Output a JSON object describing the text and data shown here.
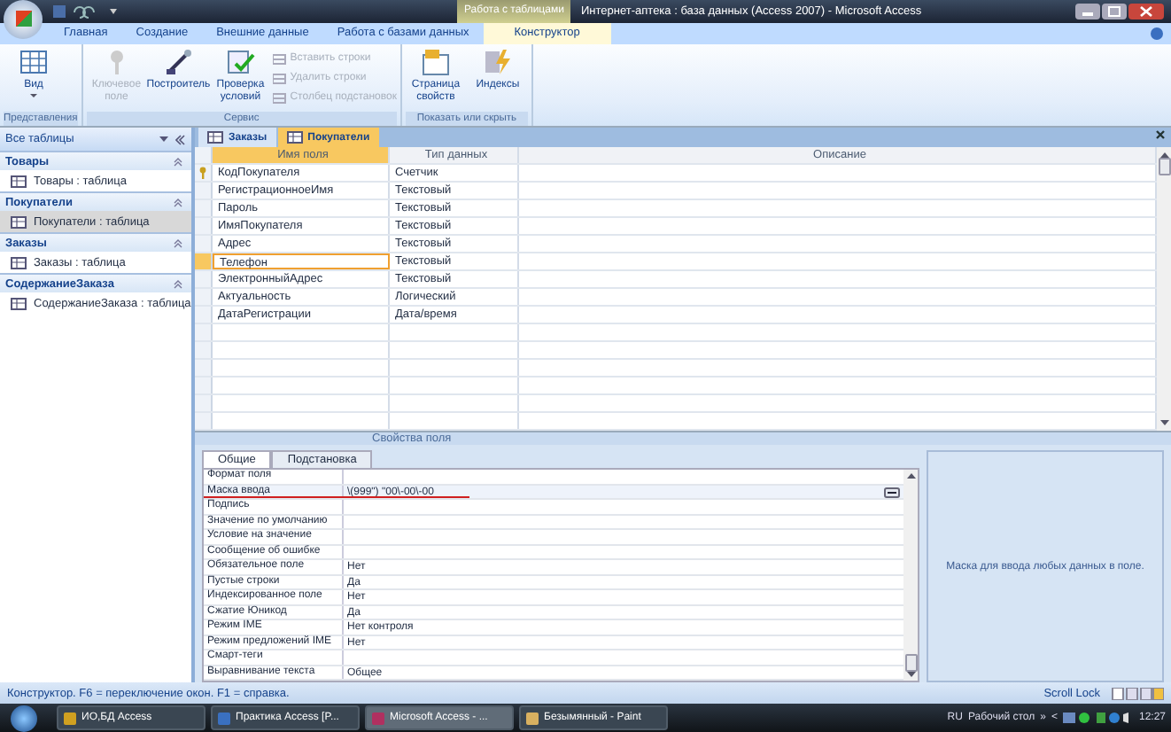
{
  "window": {
    "title": "Интернет-аптека : база данных (Access 2007) - Microsoft Access",
    "context_group": "Работа с таблицами"
  },
  "ribbon": {
    "tabs": [
      {
        "label": "Главная",
        "selected": false,
        "contextual": false
      },
      {
        "label": "Создание",
        "selected": false,
        "contextual": false
      },
      {
        "label": "Внешние данные",
        "selected": false,
        "contextual": false
      },
      {
        "label": "Работа с базами данных",
        "selected": false,
        "contextual": false
      },
      {
        "label": "Конструктор",
        "selected": true,
        "contextual": true
      }
    ],
    "groups": [
      {
        "label": "Представления",
        "buttons": [
          {
            "label": "Вид",
            "kind": "large",
            "disabled": false,
            "dropdown": true
          }
        ]
      },
      {
        "label": "Сервис",
        "buttons": [
          {
            "label": "Ключевое поле",
            "kind": "large",
            "disabled": true
          },
          {
            "label": "Построитель",
            "kind": "large",
            "disabled": false
          },
          {
            "label": "Проверка условий",
            "kind": "large",
            "disabled": false
          },
          {
            "label": "Вставить строки",
            "kind": "small",
            "disabled": true
          },
          {
            "label": "Удалить строки",
            "kind": "small",
            "disabled": true
          },
          {
            "label": "Столбец подстановок",
            "kind": "small",
            "disabled": true
          }
        ]
      },
      {
        "label": "Показать или скрыть",
        "buttons": [
          {
            "label": "Страница свойств",
            "kind": "large",
            "disabled": false
          },
          {
            "label": "Индексы",
            "kind": "large",
            "disabled": false
          }
        ]
      }
    ]
  },
  "navigation": {
    "header": "Все таблицы",
    "groups": [
      {
        "title": "Товары",
        "items": [
          {
            "label": "Товары : таблица",
            "selected": false
          }
        ]
      },
      {
        "title": "Покупатели",
        "items": [
          {
            "label": "Покупатели : таблица",
            "selected": true
          }
        ]
      },
      {
        "title": "Заказы",
        "items": [
          {
            "label": "Заказы : таблица",
            "selected": false
          }
        ]
      },
      {
        "title": "СодержаниеЗаказа",
        "items": [
          {
            "label": "СодержаниеЗаказа : таблица",
            "selected": false
          }
        ]
      }
    ]
  },
  "document_tabs": [
    {
      "label": "Заказы",
      "selected": false
    },
    {
      "label": "Покупатели",
      "selected": true
    }
  ],
  "design_grid": {
    "columns": [
      "Имя поля",
      "Тип данных",
      "Описание"
    ],
    "rows": [
      {
        "name": "КодПокупателя",
        "type": "Счетчик",
        "primary_key": true,
        "selected": false
      },
      {
        "name": "РегистрационноеИмя",
        "type": "Текстовый",
        "primary_key": false,
        "selected": false
      },
      {
        "name": "Пароль",
        "type": "Текстовый",
        "primary_key": false,
        "selected": false
      },
      {
        "name": "ИмяПокупателя",
        "type": "Текстовый",
        "primary_key": false,
        "selected": false
      },
      {
        "name": "Адрес",
        "type": "Текстовый",
        "primary_key": false,
        "selected": false
      },
      {
        "name": "Телефон",
        "type": "Текстовый",
        "primary_key": false,
        "selected": true
      },
      {
        "name": "ЭлектронныйАдрес",
        "type": "Текстовый",
        "primary_key": false,
        "selected": false
      },
      {
        "name": "Актуальность",
        "type": "Логический",
        "primary_key": false,
        "selected": false
      },
      {
        "name": "ДатаРегистрации",
        "type": "Дата/время",
        "primary_key": false,
        "selected": false
      }
    ]
  },
  "field_properties": {
    "title": "Свойства поля",
    "tabs": [
      {
        "label": "Общие",
        "selected": true
      },
      {
        "label": "Подстановка",
        "selected": false
      }
    ],
    "rows": [
      {
        "label": "Формат поля",
        "selected": false,
        "underlined": false
      },
      {
        "label": "Маска ввода",
        "value": "\\(999\") \"00\\-00\\-00",
        "selected": true,
        "underlined": true
      },
      {
        "label": "Подпись",
        "selected": false,
        "underlined": false
      },
      {
        "label": "Значение по умолчанию",
        "selected": false,
        "underlined": false
      },
      {
        "label": "Условие на значение",
        "selected": false,
        "underlined": false
      },
      {
        "label": "Сообщение об ошибке",
        "selected": false,
        "underlined": false
      },
      {
        "label": "Обязательное поле",
        "value": "Нет",
        "selected": false,
        "underlined": false
      },
      {
        "label": "Пустые строки",
        "value": "Да",
        "selected": false,
        "underlined": false
      },
      {
        "label": "Индексированное поле",
        "value": "Нет",
        "selected": false,
        "underlined": false
      },
      {
        "label": "Сжатие Юникод",
        "value": "Да",
        "selected": false,
        "underlined": false
      },
      {
        "label": "Режим IME",
        "value": "Нет контроля",
        "selected": false,
        "underlined": false
      },
      {
        "label": "Режим предложений IME",
        "value": "Нет",
        "selected": false,
        "underlined": false
      },
      {
        "label": "Смарт-теги",
        "selected": false,
        "underlined": false
      },
      {
        "label": "Выравнивание текста",
        "value": "Общее",
        "selected": false,
        "underlined": false
      }
    ],
    "hint": "Маска для ввода любых данных в поле."
  },
  "status_bar": {
    "text": "Конструктор.  F6 = переключение окон.  F1 = справка.",
    "indicator": "Scroll Lock"
  },
  "taskbar": {
    "items": [
      {
        "label": "ИО,БД Access",
        "selected": false
      },
      {
        "label": "Практика Access [P...",
        "selected": false
      },
      {
        "label": "Microsoft Access - ...",
        "selected": true
      },
      {
        "label": "Безымянный - Paint",
        "selected": false
      }
    ],
    "language": "RU",
    "toolbar": "Рабочий стол",
    "chevron": "»",
    "tray_toggle": "<",
    "clock": "12:27"
  }
}
